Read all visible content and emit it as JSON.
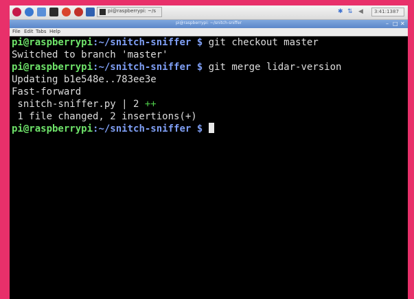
{
  "taskbar": {
    "launchers": [
      {
        "icon": "raspberry-menu-icon",
        "color": "#c51a4a"
      },
      {
        "icon": "globe-icon",
        "color": "#3a78d0"
      },
      {
        "icon": "file-manager-icon",
        "color": "#5a8fd8"
      },
      {
        "icon": "terminal-icon",
        "color": "#2b2b2b"
      },
      {
        "icon": "math-icon",
        "color": "#d9432c"
      },
      {
        "icon": "wolfram-icon",
        "color": "#c0302a"
      }
    ],
    "task_label": "pi@raspberrypi: ~/s",
    "clock": "3:41:1387"
  },
  "window": {
    "title": "pi@raspberrypi: ~/snitch-sniffer",
    "menu": [
      "File",
      "Edit",
      "Tabs",
      "Help"
    ]
  },
  "terminal": {
    "user_host": "pi@raspberrypi",
    "path": ":~/snitch-sniffer $",
    "lines": {
      "cmd1": " git checkout master",
      "out1": "Switched to branch 'master'",
      "cmd2": " git merge lidar-version",
      "out2": "Updating b1e548e..783ee3e",
      "out3": "Fast-forward",
      "out4_text": " snitch-sniffer.py | 2 ",
      "out4_plus": "++",
      "out5": " 1 file changed, 2 insertions(+)"
    }
  },
  "colors": {
    "background": "#e8306a",
    "prompt_user": "#6fe46a",
    "prompt_path": "#7f9ff5",
    "terminal_bg": "#000000"
  }
}
